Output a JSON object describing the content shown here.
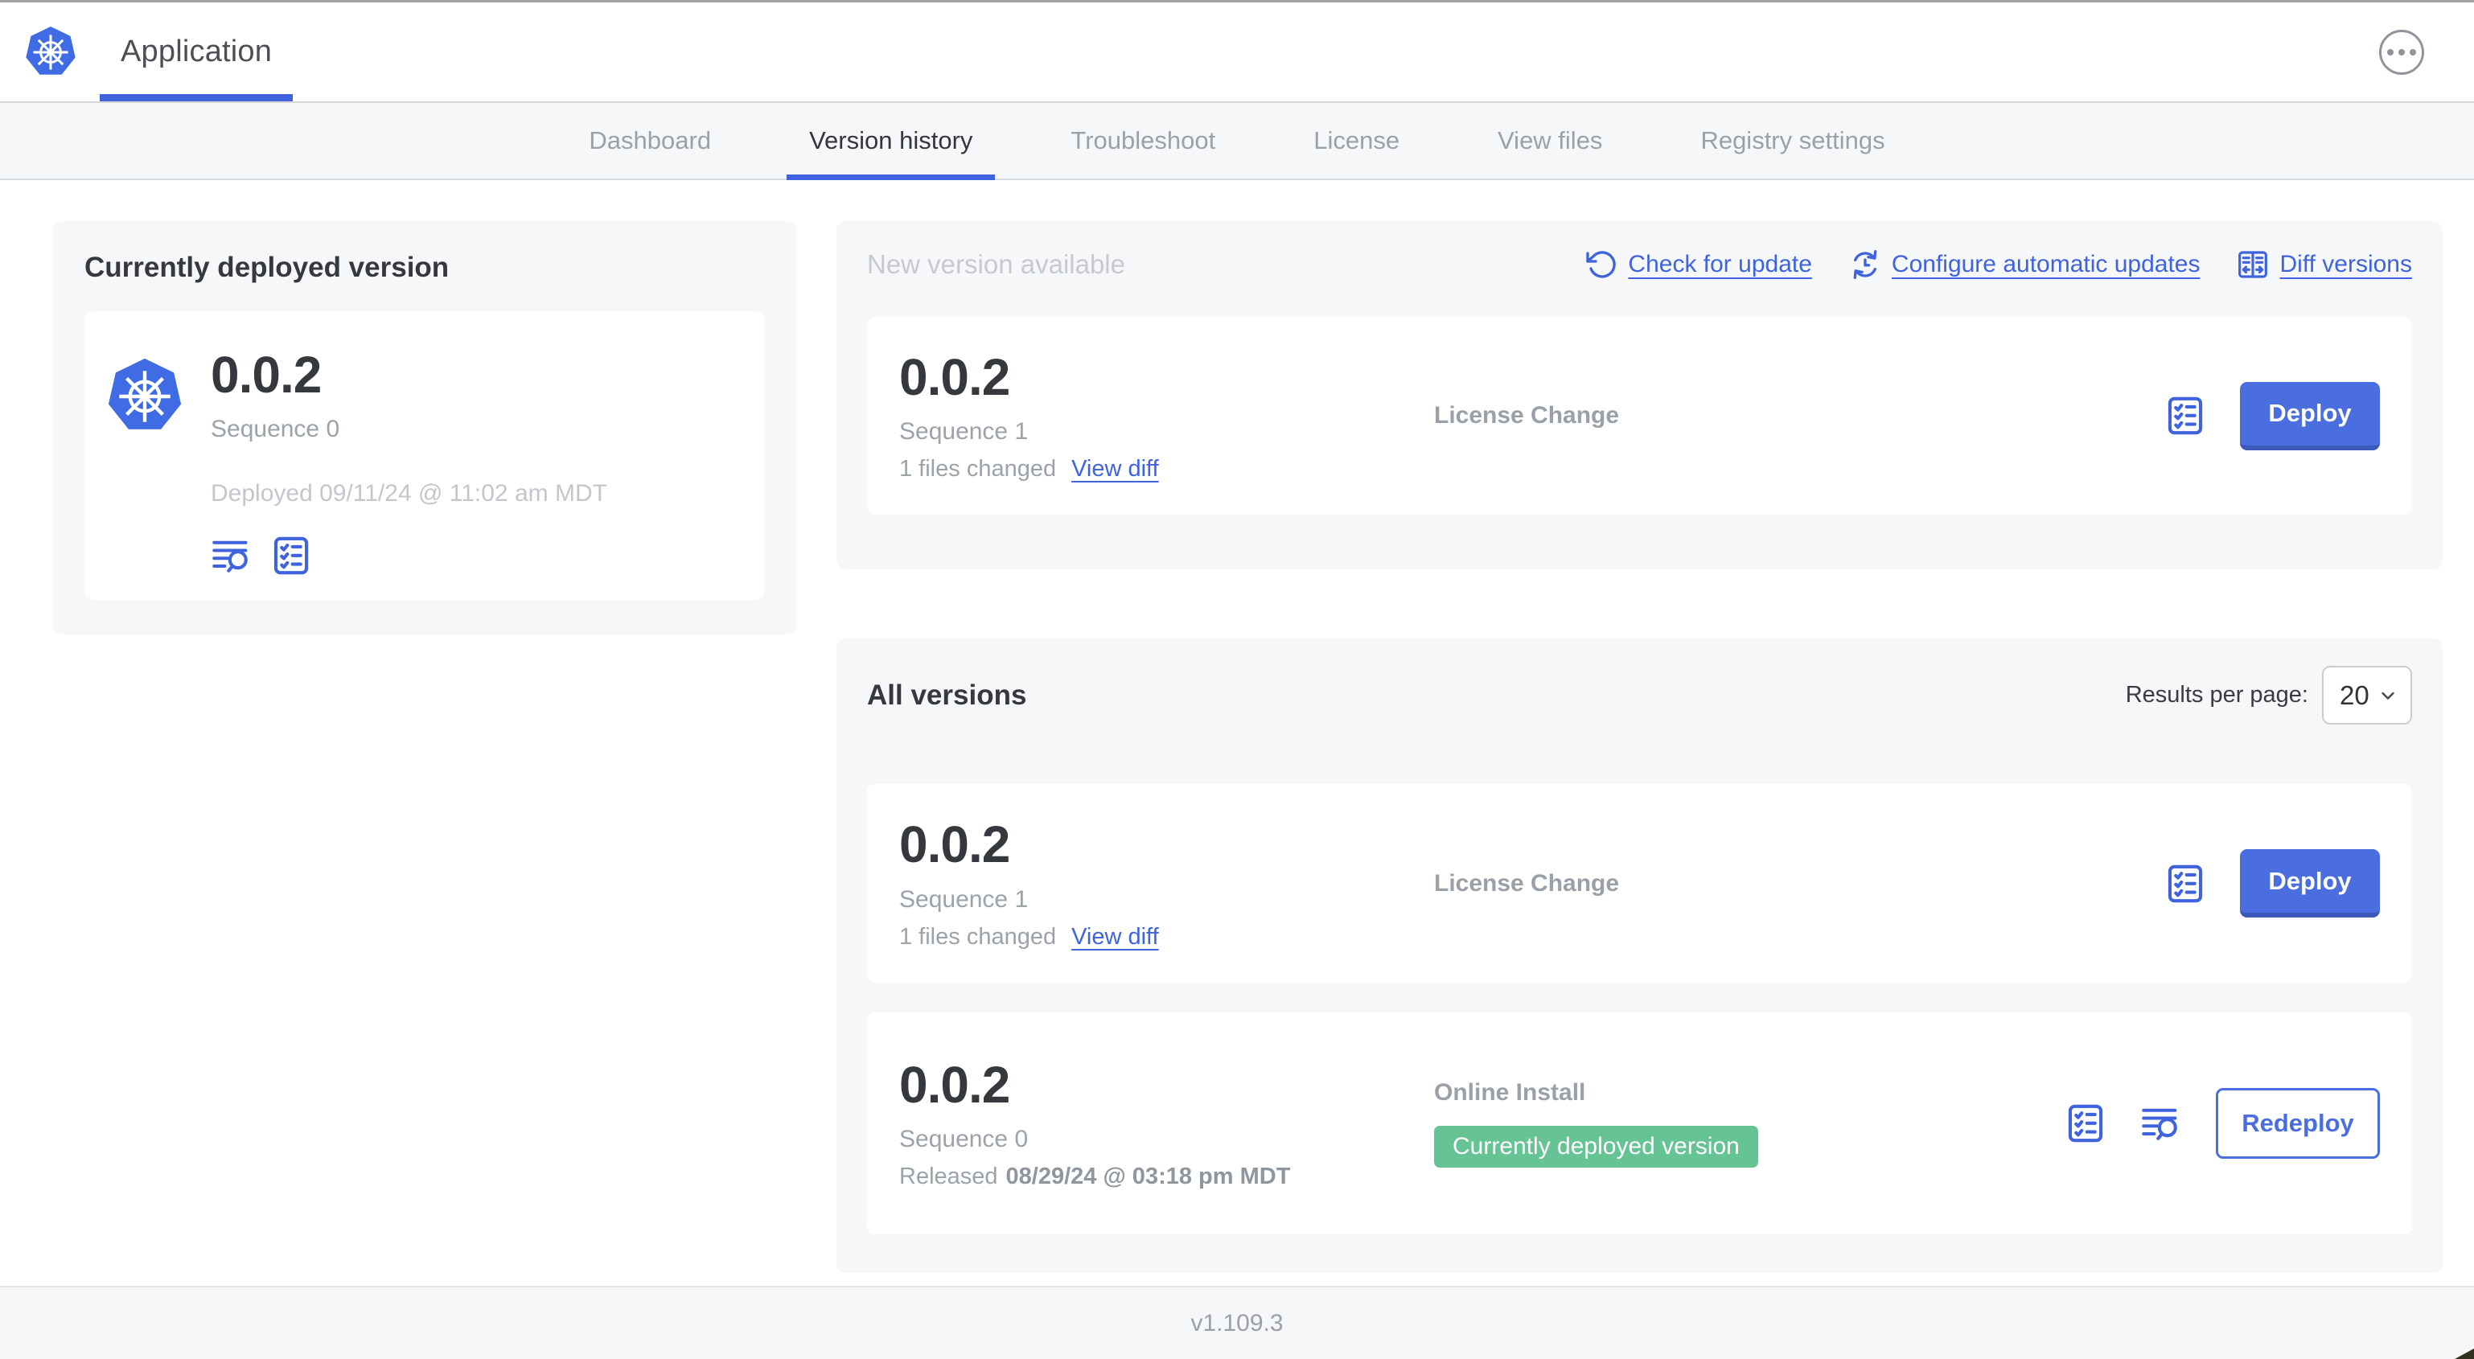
{
  "header": {
    "app_title": "Application"
  },
  "nav": {
    "tabs": [
      {
        "label": "Dashboard",
        "active": false
      },
      {
        "label": "Version history",
        "active": true
      },
      {
        "label": "Troubleshoot",
        "active": false
      },
      {
        "label": "License",
        "active": false
      },
      {
        "label": "View files",
        "active": false
      },
      {
        "label": "Registry settings",
        "active": false
      }
    ]
  },
  "deployed_panel": {
    "title": "Currently deployed version",
    "version": "0.0.2",
    "sequence": "Sequence 0",
    "deployed_at": "Deployed 09/11/24 @ 11:02 am MDT"
  },
  "new_version_section": {
    "heading": "New version available",
    "links": [
      {
        "label": "Check for update",
        "icon": "refresh-icon"
      },
      {
        "label": "Configure automatic updates",
        "icon": "auto-update-icon"
      },
      {
        "label": "Diff versions",
        "icon": "diff-icon"
      }
    ],
    "card": {
      "version": "0.0.2",
      "sequence": "Sequence 1",
      "files_changed": "1 files changed",
      "view_diff_label": "View diff",
      "source": "License Change",
      "deploy_label": "Deploy"
    }
  },
  "all_versions_section": {
    "heading": "All versions",
    "results_per_page_label": "Results per page:",
    "results_per_page_value": "20",
    "rows": [
      {
        "version": "0.0.2",
        "sequence": "Sequence 1",
        "files_changed": "1 files changed",
        "view_diff_label": "View diff",
        "source": "License Change",
        "action_label": "Deploy"
      },
      {
        "version": "0.0.2",
        "sequence": "Sequence 0",
        "released_prefix": "Released",
        "released_date": "08/29/24 @ 03:18 pm MDT",
        "source": "Online Install",
        "badge": "Currently deployed version",
        "action_label": "Redeploy"
      }
    ]
  },
  "footer": {
    "app_version": "v1.109.3"
  },
  "colors": {
    "primary_blue": "#3e63dd",
    "button_blue": "#4a6ee0",
    "kubernetes_blue": "#3f6ce5",
    "badge_green": "#65c394",
    "panel_gray": "#f6f7f9"
  }
}
